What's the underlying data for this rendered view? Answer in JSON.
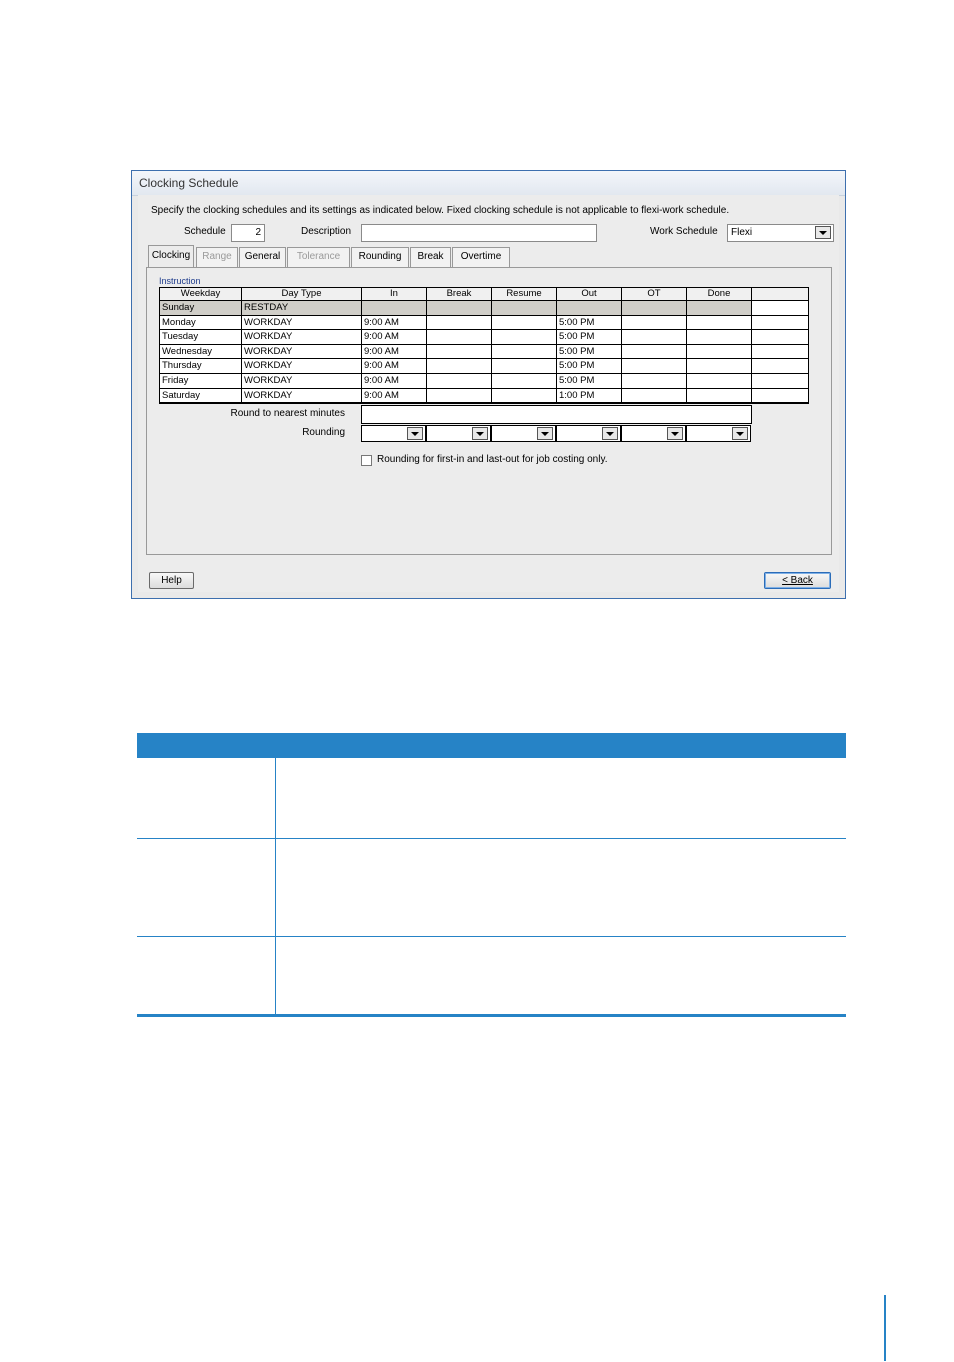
{
  "window": {
    "title": "Clocking Schedule",
    "instruction": "Specify the clocking schedules and its settings as indicated below. Fixed clocking schedule is not applicable to flexi-work schedule.",
    "schedule_label": "Schedule",
    "schedule_value": "2",
    "description_label": "Description",
    "description_value": "",
    "work_schedule_label": "Work Schedule",
    "work_schedule_value": "Flexi"
  },
  "tabs": [
    {
      "label": "Clocking",
      "state": "active"
    },
    {
      "label": "Range",
      "state": "disabled"
    },
    {
      "label": "General",
      "state": "enabled"
    },
    {
      "label": "Tolerance",
      "state": "disabled"
    },
    {
      "label": "Rounding",
      "state": "enabled"
    },
    {
      "label": "Break",
      "state": "enabled"
    },
    {
      "label": "Overtime",
      "state": "enabled"
    }
  ],
  "panel": {
    "legend": "Instruction",
    "columns": [
      "Weekday",
      "Day Type",
      "In",
      "Break",
      "Resume",
      "Out",
      "OT",
      "Done"
    ],
    "rows": [
      [
        "Sunday",
        "RESTDAY",
        "",
        "",
        "",
        "",
        "",
        ""
      ],
      [
        "Monday",
        "WORKDAY",
        "9:00 AM",
        "",
        "",
        "5:00 PM",
        "",
        ""
      ],
      [
        "Tuesday",
        "WORKDAY",
        "9:00 AM",
        "",
        "",
        "5:00 PM",
        "",
        ""
      ],
      [
        "Wednesday",
        "WORKDAY",
        "9:00 AM",
        "",
        "",
        "5:00 PM",
        "",
        ""
      ],
      [
        "Thursday",
        "WORKDAY",
        "9:00 AM",
        "",
        "",
        "5:00 PM",
        "",
        ""
      ],
      [
        "Friday",
        "WORKDAY",
        "9:00 AM",
        "",
        "",
        "5:00 PM",
        "",
        ""
      ],
      [
        "Saturday",
        "WORKDAY",
        "9:00 AM",
        "",
        "",
        "1:00 PM",
        "",
        ""
      ]
    ],
    "round_label": "Round to nearest minutes",
    "rounding_label": "Rounding",
    "checkbox_label": "Rounding for first-in and last-out for job costing only."
  },
  "buttons": {
    "help": "Help",
    "back": "< Back"
  },
  "colors": {
    "accent": "#2683c6",
    "restday_row": "#d0cec8"
  }
}
